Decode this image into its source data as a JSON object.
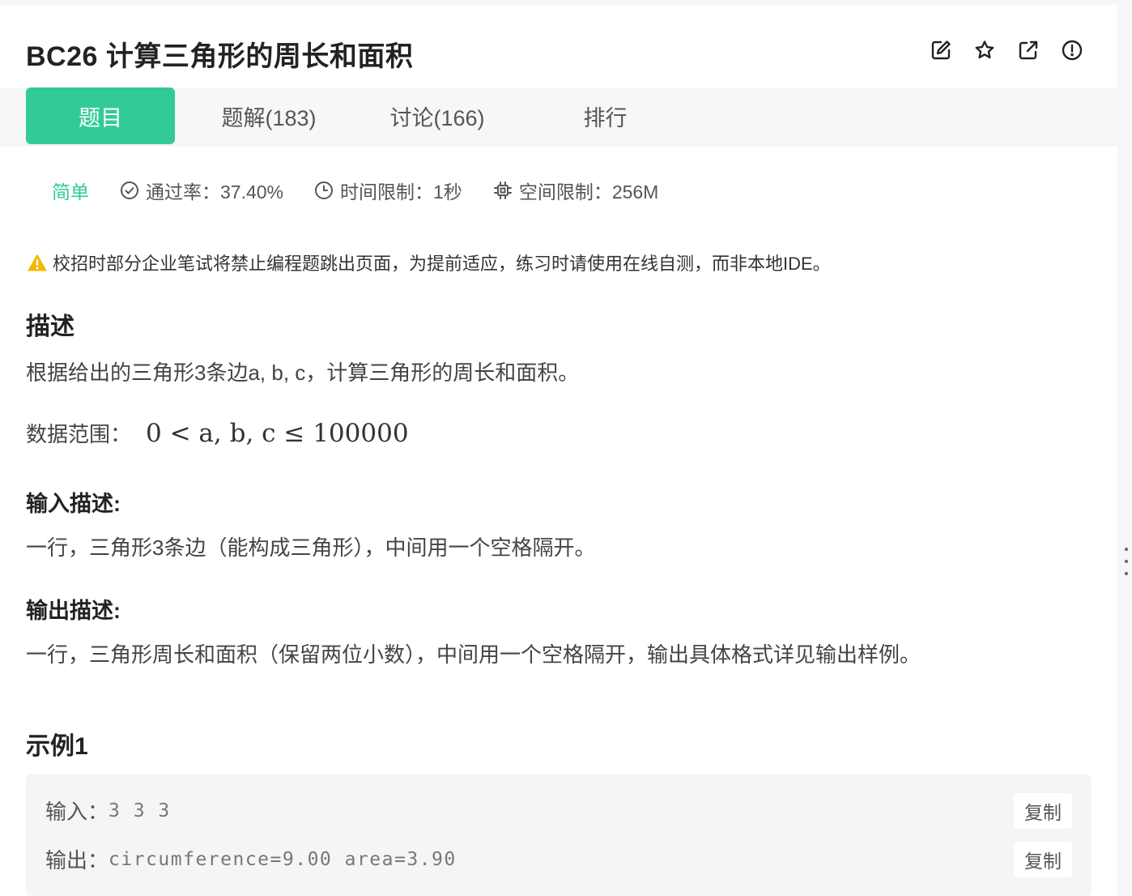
{
  "problem": {
    "title": "BC26  计算三角形的周长和面积"
  },
  "header_icons": [
    "edit-icon",
    "star-icon",
    "external-link-icon",
    "report-icon"
  ],
  "tabs": [
    {
      "label": "题目",
      "active": true
    },
    {
      "label": "题解(183)",
      "active": false
    },
    {
      "label": "讨论(166)",
      "active": false
    },
    {
      "label": "排行",
      "active": false
    }
  ],
  "meta": {
    "difficulty": "简单",
    "pass_rate": "通过率：37.40%",
    "time_limit": "时间限制：1秒",
    "space_limit": "空间限制：256M"
  },
  "warning": "校招时部分企业笔试将禁止编程题跳出页面，为提前适应，练习时请使用在线自测，而非本地IDE。",
  "description": {
    "heading": "描述",
    "text": "根据给出的三角形3条边a, b, c，计算三角形的周长和面积。",
    "range_label": "数据范围：",
    "range_math": "0 < a, b, c ≤ 100000"
  },
  "input": {
    "heading": "输入描述:",
    "text": "一行，三角形3条边（能构成三角形），中间用一个空格隔开。"
  },
  "output": {
    "heading": "输出描述:",
    "text": "一行，三角形周长和面积（保留两位小数），中间用一个空格隔开，输出具体格式详见输出样例。"
  },
  "example": {
    "heading": "示例1",
    "input_label": "输入：",
    "input_value": "3 3 3",
    "output_label": "输出：",
    "output_value": "circumference=9.00 area=3.90",
    "copy_label": "复制"
  },
  "colors": {
    "accent": "#32ca99",
    "warning": "#f5b800",
    "tab_bar": "#f6f7f9",
    "example_bg": "#f4f5f7"
  }
}
